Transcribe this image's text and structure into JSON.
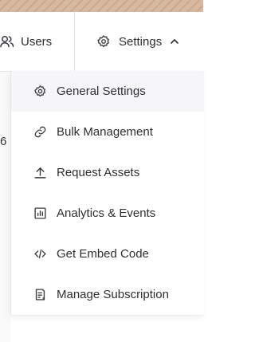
{
  "nav": {
    "users_label": "Users",
    "settings_label": "Settings"
  },
  "page": {
    "partial_text": "6"
  },
  "menu": {
    "items": [
      {
        "label": "General Settings",
        "icon": "gear-icon",
        "active": true
      },
      {
        "label": "Bulk Management",
        "icon": "link-icon",
        "active": false
      },
      {
        "label": "Request Assets",
        "icon": "upload-icon",
        "active": false
      },
      {
        "label": "Analytics & Events",
        "icon": "bar-chart-icon",
        "active": false
      },
      {
        "label": "Get Embed Code",
        "icon": "code-icon",
        "active": false
      },
      {
        "label": "Manage Subscription",
        "icon": "document-icon",
        "active": false
      }
    ]
  },
  "colors": {
    "text": "#2f2f33",
    "active_bg": "#f6f6f8",
    "border": "#e6e6ea"
  }
}
